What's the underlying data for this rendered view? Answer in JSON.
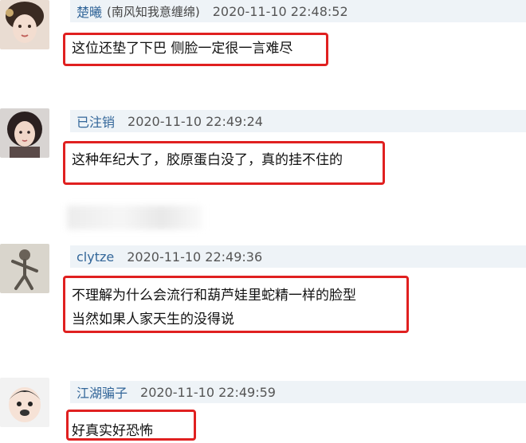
{
  "comments": [
    {
      "username": "楚曦",
      "username_suffix": "(南风知我意缠绵)",
      "time": "2020-11-10 22:48:52",
      "lines": [
        "这位还垫了下巴 侧脸一定很一言难尽"
      ]
    },
    {
      "username": "已注销",
      "username_suffix": "",
      "time": "2020-11-10 22:49:24",
      "lines": [
        "这种年纪大了，胶原蛋白没了，真的挂不住的"
      ]
    },
    {
      "username": "clytze",
      "username_suffix": "",
      "time": "2020-11-10 22:49:36",
      "lines": [
        "不理解为什么会流行和葫芦娃里蛇精一样的脸型",
        "当然如果人家天生的没得说"
      ]
    },
    {
      "username": "江湖骗子",
      "username_suffix": "",
      "time": "2020-11-10 22:49:59",
      "lines": [
        "好真实好恐怖"
      ]
    }
  ],
  "colors": {
    "highlight": "#e02020",
    "username": "#336699",
    "meta_bg": "#eef3f7"
  }
}
